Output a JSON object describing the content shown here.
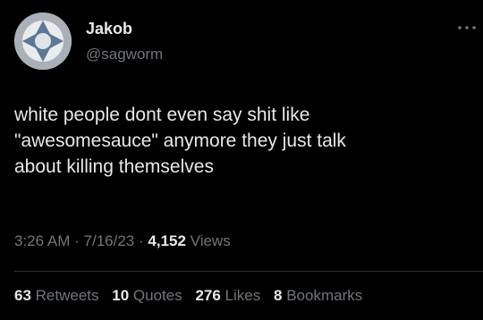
{
  "user": {
    "display_name": "Jakob",
    "handle": "@sagworm",
    "avatar_icon": "gray-emblem-avatar"
  },
  "tweet": {
    "text": "white people dont even say shit like\n\"awesomesauce\" anymore they just talk\nabout killing themselves"
  },
  "meta": {
    "time": "3:26 AM",
    "separator": "·",
    "date": "7/16/23",
    "views_count": "4,152",
    "views_label": "Views"
  },
  "stats": {
    "retweets_count": "63",
    "retweets_label": "Retweets",
    "quotes_count": "10",
    "quotes_label": "Quotes",
    "likes_count": "276",
    "likes_label": "Likes",
    "bookmarks_count": "8",
    "bookmarks_label": "Bookmarks"
  },
  "colors": {
    "background": "#000000",
    "primary_text": "#e7e9ea",
    "secondary_text": "#71767b",
    "divider": "#2f3336"
  }
}
